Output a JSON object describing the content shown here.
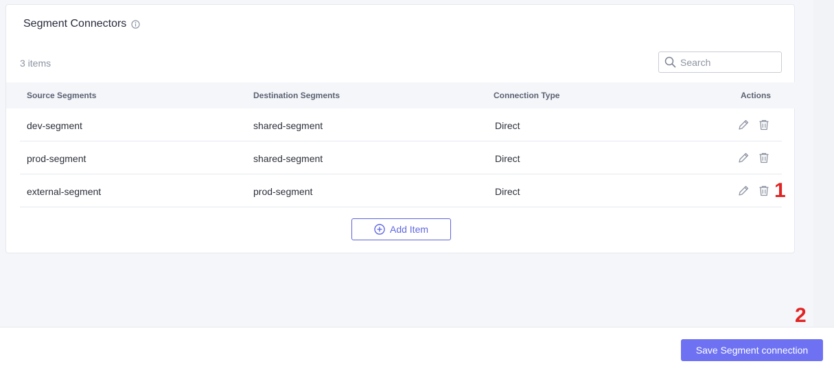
{
  "card": {
    "title": "Segment Connectors",
    "item_count": "3 items",
    "search": {
      "placeholder": "Search",
      "value": ""
    }
  },
  "table": {
    "columns": [
      {
        "label": "Source Segments"
      },
      {
        "label": "Destination Segments"
      },
      {
        "label": "Connection Type"
      },
      {
        "label": "Actions"
      }
    ],
    "rows": [
      {
        "source": "dev-segment",
        "destination": "shared-segment",
        "type": "Direct"
      },
      {
        "source": "prod-segment",
        "destination": "shared-segment",
        "type": "Direct"
      },
      {
        "source": "external-segment",
        "destination": "prod-segment",
        "type": "Direct"
      }
    ],
    "row_actions": [
      "pencil-icon",
      "trash-icon"
    ]
  },
  "add_button": {
    "label": "Add Item",
    "icon": "plus-circle-icon"
  },
  "annotations": {
    "first": "1",
    "second": "2"
  },
  "footer": {
    "save_label": "Save Segment connection"
  },
  "colors": {
    "accent": "#6e72f2",
    "outline_accent": "#5d63d6",
    "annotation": "#e02424",
    "page_bg": "#f5f6f9"
  }
}
